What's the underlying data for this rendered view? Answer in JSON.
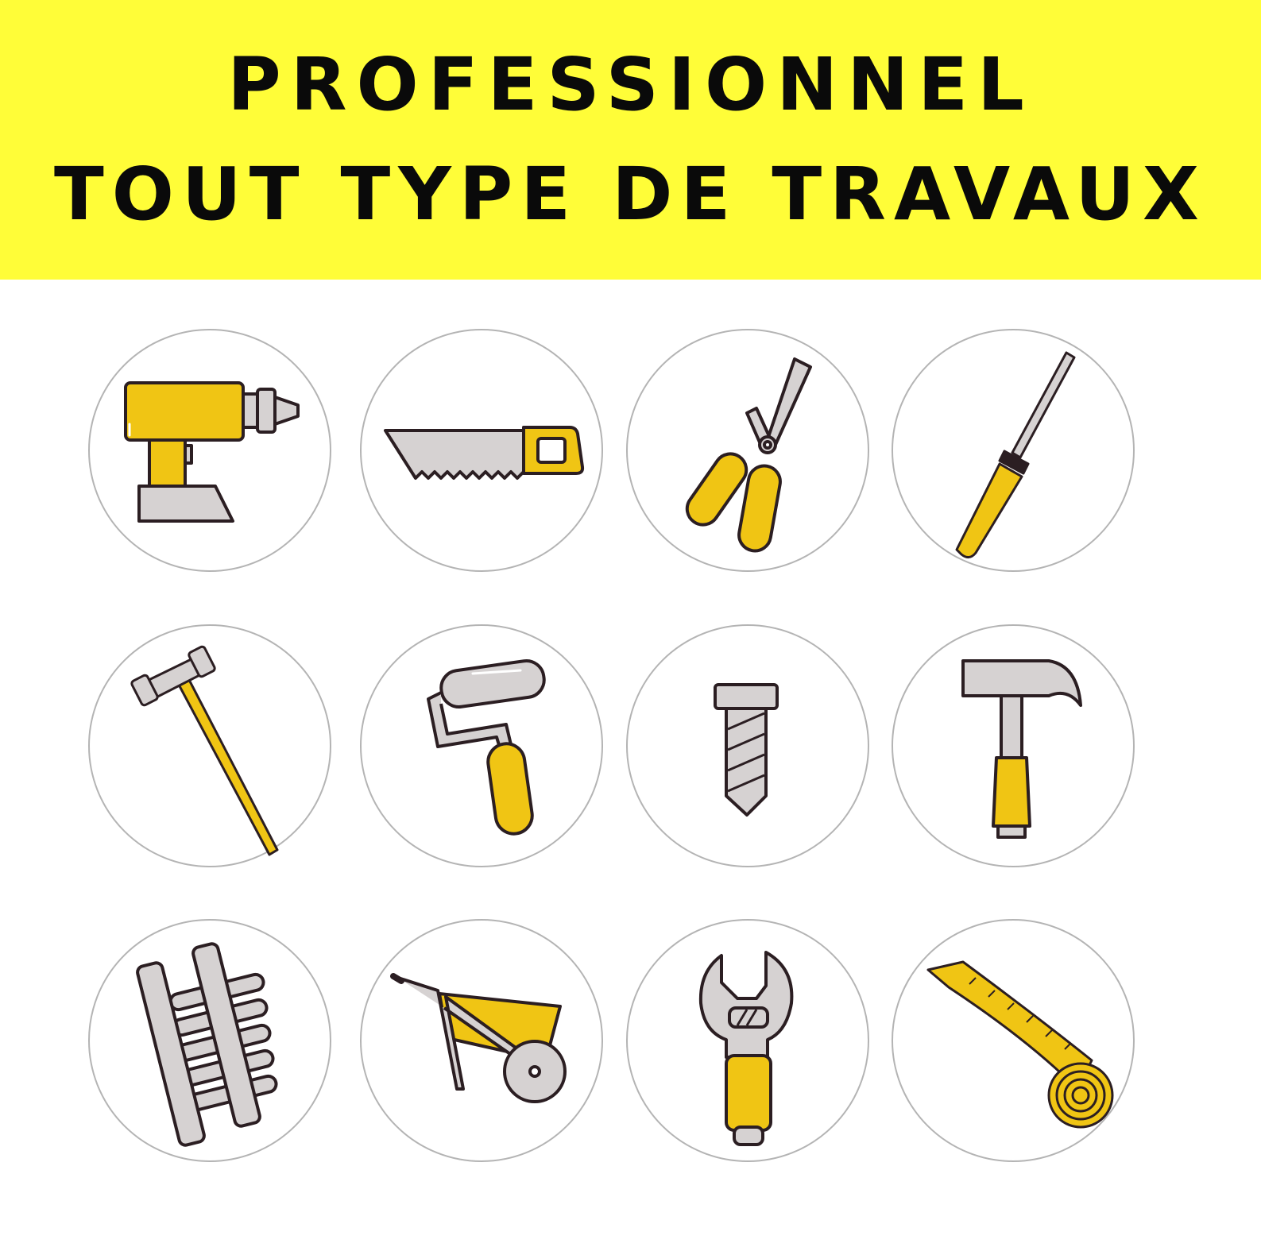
{
  "banner": {
    "line1": "PROFESSIONNEL",
    "line2": "TOUT TYPE DE TRAVAUX",
    "background_color": "#fffd38",
    "text_color": "#0a0a0a"
  },
  "tools": [
    {
      "icon": "drill-icon"
    },
    {
      "icon": "saw-icon"
    },
    {
      "icon": "pliers-icon"
    },
    {
      "icon": "screwdriver-icon"
    },
    {
      "icon": "sledgehammer-icon"
    },
    {
      "icon": "paint-roller-icon"
    },
    {
      "icon": "screw-icon"
    },
    {
      "icon": "claw-hammer-icon"
    },
    {
      "icon": "ladder-icon"
    },
    {
      "icon": "wheelbarrow-icon"
    },
    {
      "icon": "wrench-icon"
    },
    {
      "icon": "tape-measure-icon"
    }
  ],
  "colors": {
    "tool_yellow": "#f0c514",
    "tool_grey": "#d6d2d2",
    "outline": "#2b1e22",
    "circle_border": "#b4b4b4"
  }
}
